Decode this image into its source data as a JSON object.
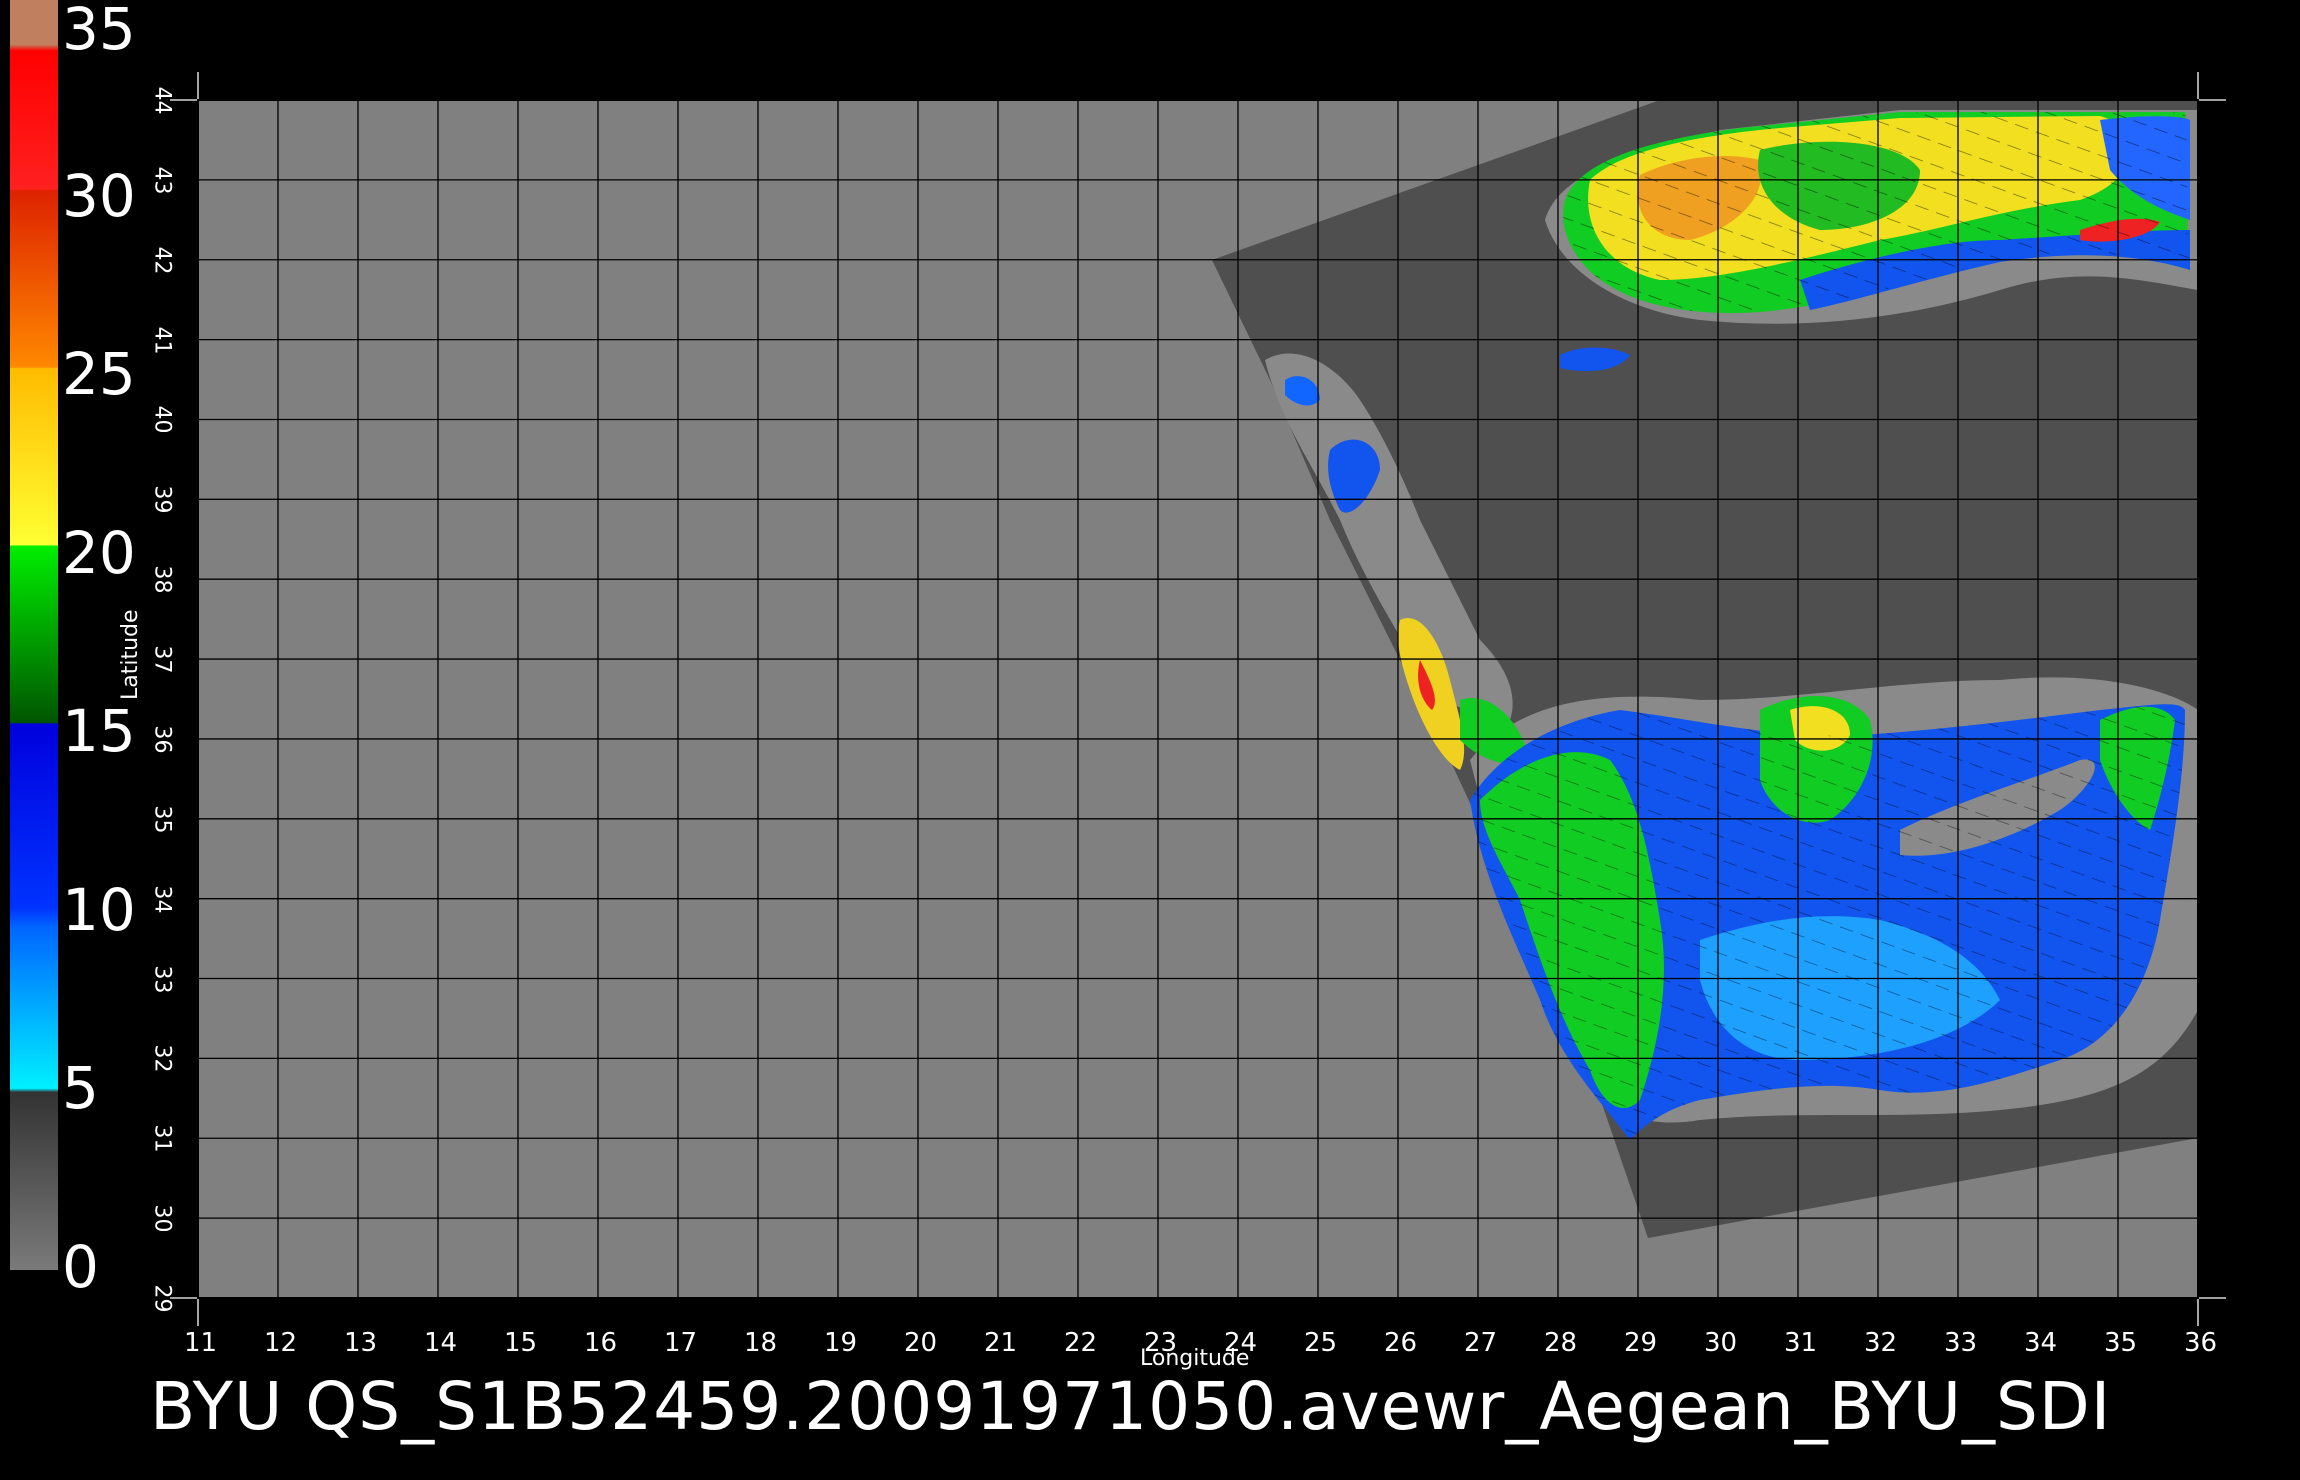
{
  "footer": {
    "title": "BYU  QS_S1B52459.20091971050.avewr_Aegean_BYU_SDI"
  },
  "axes": {
    "x_label": "Longitude",
    "y_label": "Latitude"
  },
  "chart_data": {
    "type": "heatmap",
    "xlabel": "Longitude",
    "ylabel": "Latitude",
    "xlim": [
      11,
      36
    ],
    "ylim": [
      29,
      44
    ],
    "x_ticks": [
      "11",
      "12",
      "13",
      "14",
      "15",
      "16",
      "17",
      "18",
      "19",
      "20",
      "21",
      "22",
      "23",
      "24",
      "25",
      "26",
      "27",
      "28",
      "29",
      "30",
      "31",
      "32",
      "33",
      "34",
      "35",
      "36"
    ],
    "y_ticks": [
      "29",
      "30",
      "31",
      "32",
      "33",
      "34",
      "35",
      "36",
      "37",
      "38",
      "39",
      "40",
      "41",
      "42",
      "43",
      "44"
    ],
    "grid": true,
    "colorbar": {
      "ticks": [
        "0",
        "5",
        "10",
        "15",
        "20",
        "25",
        "30",
        "35"
      ],
      "range": [
        0,
        35
      ],
      "colors": [
        "#777777",
        "#2a2a2a",
        "#00eeff",
        "#0066ff",
        "#0030ff",
        "#006600",
        "#00dd00",
        "#ffff33",
        "#ffcc00",
        "#ff8800",
        "#ff2222",
        "#c08060"
      ]
    }
  },
  "colors": {
    "background": "#000000",
    "plot_bg": "#808080",
    "swath": "#4f4f4f",
    "land_mask": "#8a8a8a",
    "grid": "#000000"
  }
}
